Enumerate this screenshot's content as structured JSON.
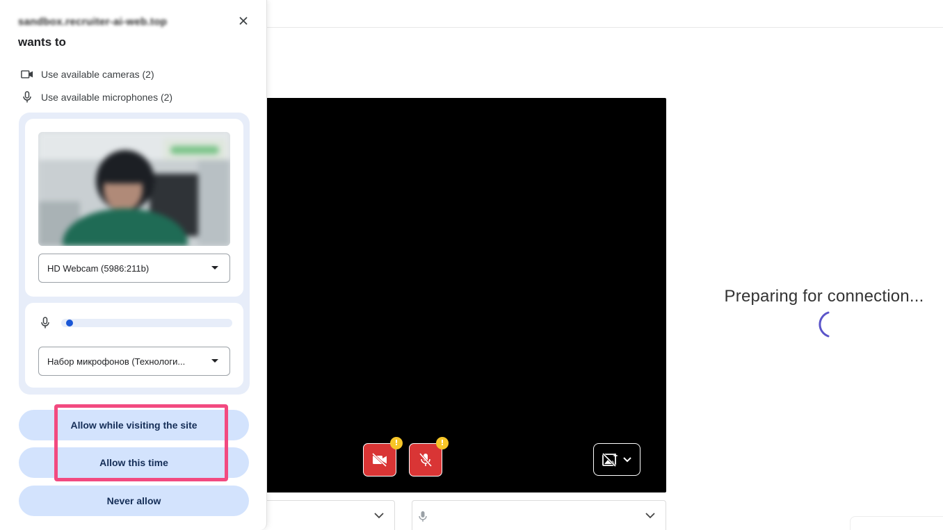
{
  "permission_prompt": {
    "site_name": "sandbox.recruiter-ai-web.top",
    "heading": "wants to",
    "permissions": [
      {
        "icon": "camera-icon",
        "label": "Use available cameras (2)"
      },
      {
        "icon": "microphone-icon",
        "label": "Use available microphones (2)"
      }
    ],
    "camera_select_value": "HD Webcam (5986:211b)",
    "microphone_select_value": "Набор микрофонов (Технологи...",
    "mic_level": 0.03,
    "buttons": {
      "allow_site": "Allow while visiting the site",
      "allow_once": "Allow this time",
      "never": "Never allow"
    }
  },
  "main": {
    "status_text": "Preparing for connection...",
    "camera_warning_badge": "!",
    "mic_warning_badge": "!"
  },
  "colors": {
    "accent_button": "#d3e3fd",
    "highlight": "#f24a80",
    "muted_red": "#d93535",
    "warning": "#f7c628",
    "spinner": "#5b55c9"
  }
}
